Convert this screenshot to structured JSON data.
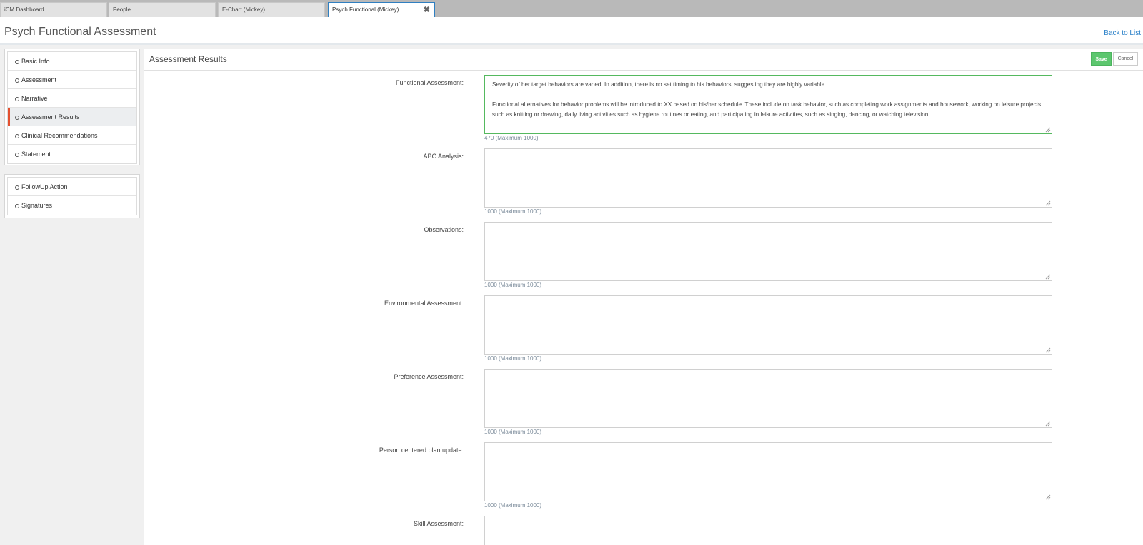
{
  "tabs": [
    {
      "label": "iCM Dashboard"
    },
    {
      "label": "People"
    },
    {
      "label": "E-Chart (Mickey)"
    },
    {
      "label": "Psych Functional (Mickey)",
      "close_icon": "✖"
    }
  ],
  "header": {
    "title": "Psych Functional Assessment",
    "back_link": "Back to List"
  },
  "nav": {
    "group1": [
      {
        "label": "Basic Info"
      },
      {
        "label": "Assessment"
      },
      {
        "label": "Narrative"
      },
      {
        "label": "Assessment Results"
      },
      {
        "label": "Clinical Recommendations"
      },
      {
        "label": "Statement"
      }
    ],
    "group2": [
      {
        "label": "FollowUp Action"
      },
      {
        "label": "Signatures"
      }
    ],
    "active_color": "#e4502f"
  },
  "main": {
    "title": "Assessment Results",
    "save_label": "Save",
    "cancel_label": "Cancel",
    "fields": [
      {
        "label": "Functional Assessment:",
        "value": "Severity of her target behaviors are varied. In addition, there is no set timing to his  behaviors, suggesting they are highly variable.\n\nFunctional alternatives for behavior problems will be introduced to XX based on his/her schedule. These include on task behavior, such as completing work assignments and housework, working on leisure projects such as knitting or drawing, daily living activities such as hygiene routines or eating,  and participating in leisure activities, such as singing, dancing, or watching television.",
        "count": "470 (Maximum 1000)"
      },
      {
        "label": "ABC Analysis:",
        "value": "",
        "count": "1000 (Maximum 1000)"
      },
      {
        "label": "Observations:",
        "value": "",
        "count": "1000 (Maximum 1000)"
      },
      {
        "label": "Environmental Assessment:",
        "value": "",
        "count": "1000 (Maximum 1000)"
      },
      {
        "label": "Preference Assessment:",
        "value": "",
        "count": "1000 (Maximum 1000)"
      },
      {
        "label": "Person centered plan update:",
        "value": "",
        "count": "1000 (Maximum 1000)"
      },
      {
        "label": "Skill Assessment:",
        "value": "",
        "count": ""
      }
    ]
  },
  "colors": {
    "save_green": "#5cc66e",
    "focus_green": "#55b95f",
    "link_blue": "#2a80c8",
    "active_tab_border": "#2f7fc1"
  }
}
